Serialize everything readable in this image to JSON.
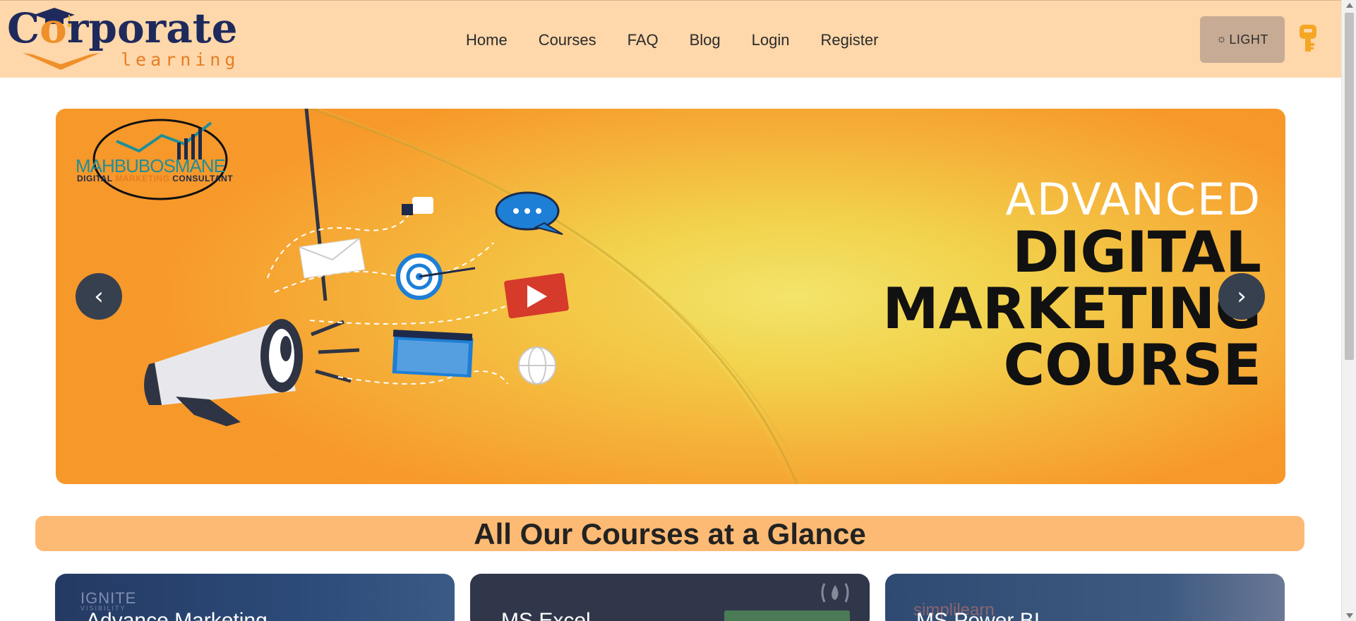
{
  "header": {
    "logo": {
      "main_text": "Corporate",
      "sub_text": "learning"
    },
    "nav": [
      {
        "label": "Home"
      },
      {
        "label": "Courses"
      },
      {
        "label": "FAQ"
      },
      {
        "label": "Blog"
      },
      {
        "label": "Login"
      },
      {
        "label": "Register"
      }
    ],
    "theme_button": {
      "label": "LIGHT",
      "icon": "sun-icon"
    },
    "key_icon": "key-icon"
  },
  "carousel": {
    "slide": {
      "brand_name": "MAHBUBOSMANE",
      "brand_tagline_a": "DIGITAL ",
      "brand_tagline_b": "MARKETING",
      "brand_tagline_c": " CONSULTANT",
      "headline_line1": "ADVANCED",
      "headline_line2": "DIGITAL",
      "headline_line3": "MARKETING",
      "headline_line4": "COURSE"
    },
    "prev_label": "‹",
    "next_label": "›"
  },
  "section": {
    "title": "All Our Courses at a Glance"
  },
  "courses": [
    {
      "title": "Advance Marketing",
      "brand": "IGNITE",
      "brand_sub": "VISIBILITY"
    },
    {
      "title": "MS Excel"
    },
    {
      "title": "MS Power BI",
      "brand": "simplilearn"
    }
  ],
  "colors": {
    "header_bg": "#fed7aa",
    "section_bg": "#fdba74",
    "nav_text": "#2b2b2b",
    "carousel_button": "#37404f"
  }
}
